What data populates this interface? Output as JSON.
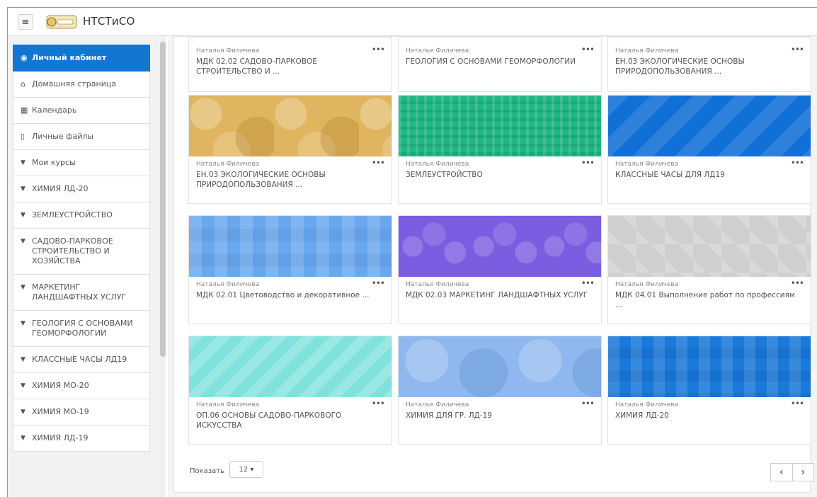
{
  "header": {
    "site_name": "НТСТиСО",
    "menu_icon": "hamburger-icon"
  },
  "sidebar": {
    "items": [
      {
        "label": "Личный кабинет",
        "icon": "dashboard-icon",
        "active": true
      },
      {
        "label": "Домашняя страница",
        "icon": "home-icon"
      },
      {
        "label": "Календарь",
        "icon": "calendar-icon"
      },
      {
        "label": "Личные файлы",
        "icon": "file-icon"
      },
      {
        "label": "Мои курсы",
        "icon": "graduation-cap-icon"
      },
      {
        "label": "ХИМИЯ ЛД-20",
        "icon": "graduation-cap-icon"
      },
      {
        "label": "ЗЕМЛЕУСТРОЙСТВО",
        "icon": "graduation-cap-icon"
      },
      {
        "label": "САДОВО-ПАРКОВОЕ СТРОИТЕЛЬСТВО И ХОЗЯЙСТВА",
        "icon": "graduation-cap-icon"
      },
      {
        "label": "МАРКЕТИНГ ЛАНДШАФТНЫХ УСЛУГ",
        "icon": "graduation-cap-icon"
      },
      {
        "label": "ГЕОЛОГИЯ С ОСНОВАМИ ГЕОМОРФОЛОГИИ",
        "icon": "graduation-cap-icon"
      },
      {
        "label": "КЛАССНЫЕ ЧАСЫ ЛД19",
        "icon": "graduation-cap-icon"
      },
      {
        "label": "ХИМИЯ МО-20",
        "icon": "graduation-cap-icon"
      },
      {
        "label": "ХИМИЯ МО-19",
        "icon": "graduation-cap-icon"
      },
      {
        "label": "ХИМИЯ ЛД-19",
        "icon": "graduation-cap-icon"
      }
    ]
  },
  "courses": [
    {
      "teacher": "Наталья Филичева",
      "title": "МДК 02.02 САДОВО-ПАРКОВОЕ СТРОИТЕЛЬСТВО И ...",
      "color": "#ffffff"
    },
    {
      "teacher": "Наталья Филичева",
      "title": "ГЕОЛОГИЯ С ОСНОВАМИ ГЕОМОРФОЛОГИИ",
      "color": "#ffffff"
    },
    {
      "teacher": "Наталья Филичева",
      "title": "ЕН.03 ЭКОЛОГИЧЕСКИЕ ОСНОВЫ ПРИРОДОПОЛЬЗОВАНИЯ ...",
      "color": "#ffffff"
    },
    {
      "teacher": "Наталья Филичева",
      "title": "ЕН.03 ЭКОЛОГИЧЕСКИЕ ОСНОВЫ ПРИРОДОПОЛЬЗОВАНИЯ ...",
      "color": "#e0b55f"
    },
    {
      "teacher": "Наталья Филичева",
      "title": "ЗЕМЛЕУСТРОЙСТВО",
      "color": "#1fb784"
    },
    {
      "teacher": "Наталья Филичева",
      "title": "КЛАССНЫЕ ЧАСЫ ДЛЯ ЛД19",
      "color": "#1170d6"
    },
    {
      "teacher": "Наталья Филичева",
      "title": "МДК 02.01 Цветоводство и декоративное ...",
      "color": "#6aa8ee"
    },
    {
      "teacher": "Наталья Филичева",
      "title": "МДК 02.03 МАРКЕТИНГ ЛАНДШАФТНЫХ УСЛУГ",
      "color": "#7a5de0"
    },
    {
      "teacher": "Наталья Филичева",
      "title": "МДК 04.01 Выполнение работ по профессиям ...",
      "color": "#cfcfcf"
    },
    {
      "teacher": "Наталья Филичева",
      "title": "ОП.06 ОСНОВЫ САДОВО-ПАРКОВОГО ИСКУССТВА",
      "color": "#7fe2dd"
    },
    {
      "teacher": "Наталья Филичева",
      "title": "ХИМИЯ ДЛЯ ГР. ЛД-19",
      "color": "#8fb9ee"
    },
    {
      "teacher": "Наталья Филичева",
      "title": "ХИМИЯ ЛД-20",
      "color": "#1b7ad9"
    }
  ],
  "pagination": {
    "show_label": "Показать",
    "per_page": "12 ▾",
    "prev": "‹",
    "next": "›"
  }
}
